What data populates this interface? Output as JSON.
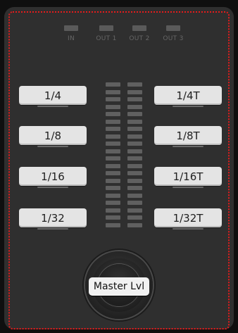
{
  "leds": {
    "in": "IN",
    "out1": "OUT 1",
    "out2": "OUT 2",
    "out3": "OUT 3"
  },
  "buttons": {
    "quarter": "1/4",
    "quarter_t": "1/4T",
    "eighth": "1/8",
    "eighth_t": "1/8T",
    "sixteenth": "1/16",
    "sixteenth_t": "1/16T",
    "thirtysecond": "1/32",
    "thirtysecond_t": "1/32T"
  },
  "knob": {
    "label": "Master Lvl"
  },
  "colors": {
    "panel": "#2f2f2f",
    "highlight_border": "#e51b1b",
    "button_face": "#e4e4e4",
    "meter_segment": "#606060"
  }
}
